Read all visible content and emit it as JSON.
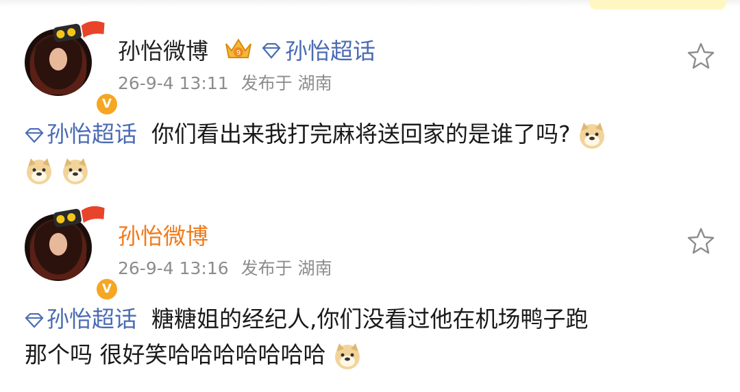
{
  "posts": [
    {
      "name": "孙怡微博",
      "chaohua": "孙怡超话",
      "time": "26-9-4 13:11",
      "location": "发布于 湖南",
      "tag": "孙怡超话",
      "text": "你们看出来我打完麻将送回家的是谁了吗?",
      "emoji_count": 3,
      "has_crown": true,
      "name_color": "#222222"
    },
    {
      "name": "孙怡微博",
      "time": "26-9-4 13:16",
      "location": "发布于 湖南",
      "tag": "孙怡超话",
      "text_line1": "糖糖姐的经纪人,你们没看过他在机场鸭子跑",
      "text_line2": "那个吗 很好笑哈哈哈哈哈哈哈",
      "emoji_count": 1,
      "has_crown": false,
      "name_color": "#f07a1a"
    }
  ],
  "colors": {
    "link_blue": "#4a6bb3",
    "meta_gray": "#8c8c8c",
    "verified_orange": "#f5a623"
  },
  "icons": {
    "avatar_badge": "tiger-new-year-badge-icon",
    "verified": "verified-v-icon",
    "crown": "vip-crown-icon",
    "diamond": "diamond-icon",
    "star": "star-outline-icon",
    "emoji": "doge-emoji-icon"
  }
}
